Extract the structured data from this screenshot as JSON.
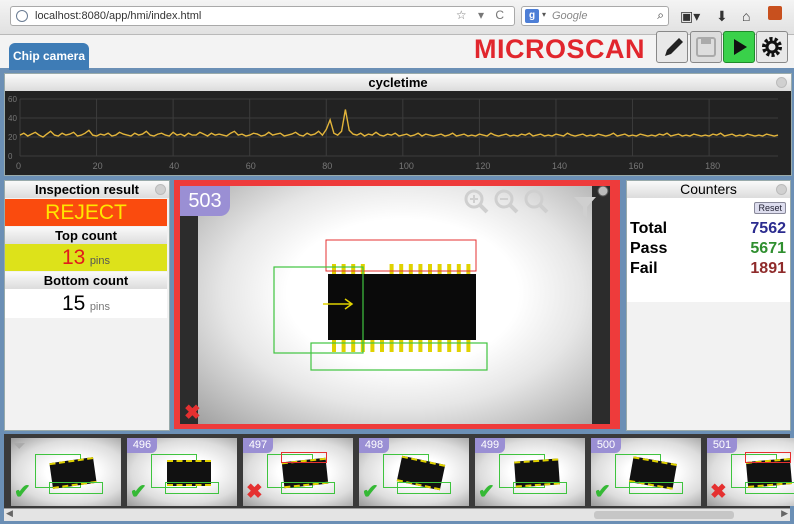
{
  "browser": {
    "url": "localhost:8080/app/hmi/index.html",
    "search_engine": "g",
    "search_placeholder": "Google",
    "url_controls": "☆ ▾ C"
  },
  "tab": {
    "label": "Chip camera"
  },
  "logo": "MICROSCAN",
  "toolbar": {
    "icons": [
      "pencil-icon",
      "save-icon",
      "play-icon",
      "gear-icon"
    ]
  },
  "cycletime": {
    "title": "cycletime",
    "y_ticks": [
      "60",
      "40",
      "20",
      "0"
    ],
    "x_ticks": [
      "0",
      "20",
      "40",
      "60",
      "80",
      "100",
      "120",
      "140",
      "160",
      "180"
    ]
  },
  "chart_data": {
    "type": "line",
    "title": "cycletime",
    "xlabel": "",
    "ylabel": "",
    "xlim": [
      0,
      198
    ],
    "ylim": [
      0,
      60
    ],
    "grid": true,
    "series": [
      {
        "values": [
          22,
          24,
          21,
          23,
          25,
          22,
          20,
          23,
          26,
          22,
          21,
          24,
          22,
          23,
          25,
          21,
          22,
          24,
          27,
          22,
          21,
          23,
          22,
          24,
          21,
          22,
          25,
          23,
          22,
          21,
          24,
          22,
          23,
          26,
          22,
          21,
          23,
          24,
          22,
          21,
          25,
          22,
          23,
          21,
          24,
          22,
          22,
          25,
          23,
          21,
          24,
          22,
          23,
          22,
          21,
          24,
          26,
          22,
          23,
          21,
          22,
          24,
          23,
          21,
          22,
          25,
          22,
          23,
          24,
          21,
          22,
          23,
          25,
          22,
          21,
          24,
          22,
          23,
          26,
          22,
          28,
          38,
          24,
          22,
          26,
          49,
          27,
          23,
          22,
          24,
          21,
          23,
          22,
          25,
          22,
          21,
          23,
          22,
          24,
          21,
          22,
          23,
          21,
          22,
          24,
          21,
          23,
          22,
          21,
          22,
          23,
          21,
          22,
          24,
          21,
          22,
          23,
          21,
          22,
          21,
          23,
          22,
          21,
          24,
          22,
          21,
          22,
          23,
          21,
          22,
          21,
          23,
          22,
          24,
          21,
          22,
          23,
          21,
          22,
          21,
          23,
          22,
          21,
          24,
          22,
          21,
          22,
          23,
          21,
          22,
          21,
          23,
          22,
          21,
          22,
          24,
          21,
          22,
          23,
          21,
          22,
          21,
          23,
          22,
          21,
          22,
          21,
          23,
          22,
          24,
          21,
          22,
          23,
          21,
          22,
          21,
          23,
          22,
          21,
          22,
          21,
          23,
          22,
          24,
          21,
          22,
          23,
          21,
          22,
          21,
          23,
          22,
          21,
          22,
          21,
          23,
          22,
          21,
          22
        ]
      }
    ]
  },
  "inspection": {
    "title": "Inspection result",
    "result": "REJECT",
    "top_label": "Top count",
    "top_value": "13",
    "top_unit": "pins",
    "bottom_label": "Bottom count",
    "bottom_value": "15",
    "bottom_unit": "pins"
  },
  "image_view": {
    "image_number": "503",
    "status": "fail",
    "tools": [
      "zoom-in-icon",
      "zoom-out-icon",
      "zoom-fit-icon",
      "filter-icon"
    ]
  },
  "counters": {
    "title": "Counters",
    "reset_label": "Reset",
    "rows": [
      {
        "label": "Total",
        "value": "7562",
        "color": "#2b2b8f"
      },
      {
        "label": "Pass",
        "value": "5671",
        "color": "#2f8f2f"
      },
      {
        "label": "Fail",
        "value": "1891",
        "color": "#8f2b2b"
      }
    ]
  },
  "filmstrip": [
    {
      "num": "",
      "status": "pass"
    },
    {
      "num": "496",
      "status": "pass"
    },
    {
      "num": "497",
      "status": "fail"
    },
    {
      "num": "498",
      "status": "pass"
    },
    {
      "num": "499",
      "status": "pass"
    },
    {
      "num": "500",
      "status": "pass"
    },
    {
      "num": "501",
      "status": "fail"
    }
  ],
  "colors": {
    "reject": "#fa4b0e",
    "reject_text": "#ffe600",
    "top_count_bg": "#dde21a",
    "top_count_text": "#e11b1b",
    "logo": "#e1262d",
    "frame_fail": "#ee3b3b"
  }
}
